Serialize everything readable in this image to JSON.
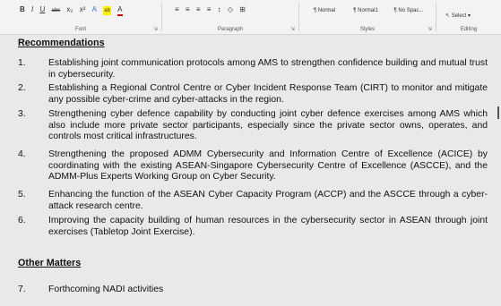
{
  "ribbon": {
    "font_tools": [
      "B",
      "I",
      "U",
      "abc",
      "x₂",
      "x²",
      "A",
      "ab",
      "A"
    ],
    "font_label": "Font",
    "paragraph_tools": [
      "≡",
      "≡",
      "≡",
      "≡",
      "↕",
      "◇",
      "⊞"
    ],
    "paragraph_label": "Paragraph",
    "styles": [
      "¶ Normal",
      "¶ Normal1",
      "¶ No Spac..."
    ],
    "styles_label": "Styles",
    "select_label": "Select",
    "editing_label": "Editing"
  },
  "document": {
    "recommendations_heading": "Recommendations",
    "recommendations": [
      {
        "num": "1.",
        "text": "Establishing joint communication protocols among AMS to strengthen confidence building and mutual trust in cybersecurity."
      },
      {
        "num": "2.",
        "text": "Establishing a Regional Control Centre or Cyber Incident Response Team (CIRT) to monitor and mitigate any possible cyber-crime and cyber-attacks in the region."
      },
      {
        "num": "3.",
        "text": "Strengthening cyber defence capability by conducting joint cyber defence exercises among AMS which also include more private sector participants, especially since the private sector owns, operates, and controls most critical infrastructures."
      },
      {
        "num": "4.",
        "text": "Strengthening the proposed ADMM Cybersecurity and Information Centre of Excellence (ACICE) by coordinating with the existing ASEAN-Singapore Cybersecurity Centre of Excellence (ASCCE), and the ADMM-Plus Experts Working Group on Cyber Security."
      },
      {
        "num": "5.",
        "text": "Enhancing the function of the ASEAN Cyber Capacity Program (ACCP) and the ASCCE through a cyber-attack research centre."
      },
      {
        "num": "6.",
        "text": "Improving the capacity building of human resources in the cybersecurity sector in ASEAN through joint exercises (Tabletop Joint Exercise)."
      }
    ],
    "other_heading": "Other Matters",
    "other_items": [
      {
        "num": "7.",
        "text": "Forthcoming NADI activities"
      }
    ]
  }
}
